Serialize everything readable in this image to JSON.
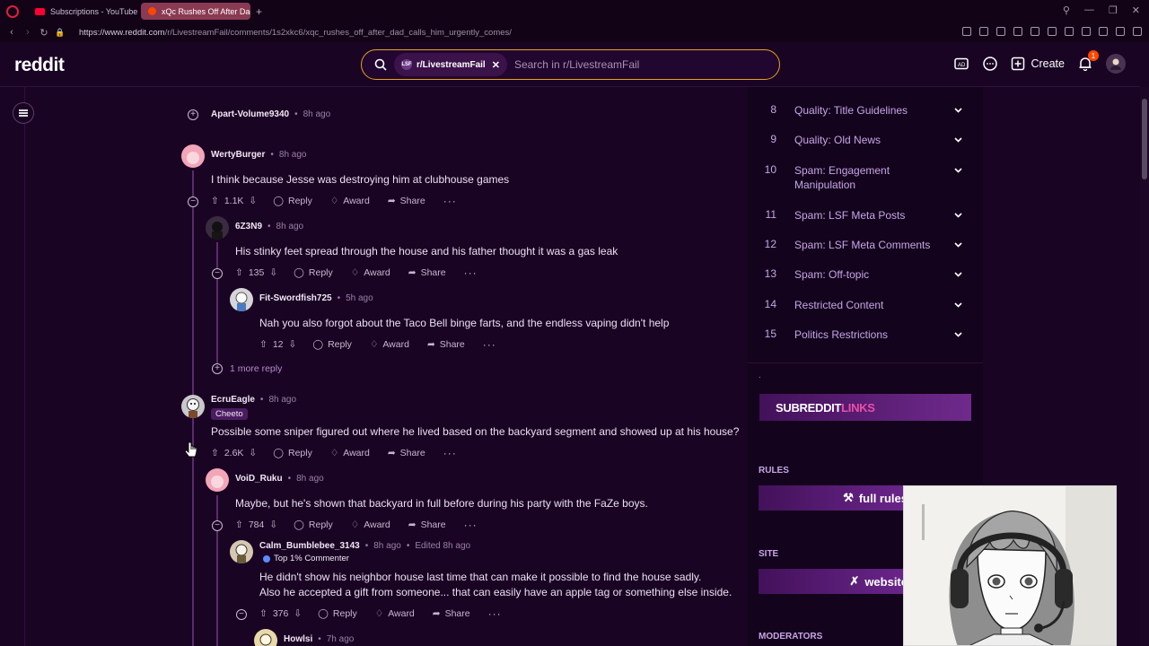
{
  "browser": {
    "tabs": [
      {
        "title": "Subscriptions - YouTube",
        "active": false,
        "fav_color": "#ff0033"
      },
      {
        "title": "xQc Rushes Off After Dad",
        "active": true,
        "fav_color": "#ff4500"
      }
    ],
    "url_host": "https://www.reddit.com",
    "url_path": "/r/LivestreamFail/comments/1s2xkc6/xqc_rushes_off_after_dad_calls_him_urgently_comes/"
  },
  "header": {
    "logo": "reddit",
    "search_chip": "r/LivestreamFail",
    "search_placeholder": "Search in r/LivestreamFail",
    "create_label": "Create",
    "notification_count": "1",
    "accent": "#e8a317"
  },
  "comments": [
    {
      "author": "Apart-Volume9340",
      "time": "8h ago",
      "collapsed": true
    },
    {
      "author": "WertyBurger",
      "time": "8h ago",
      "body": "I think because Jesse was destroying him at clubhouse games",
      "score": "1.1K",
      "reply": "Reply",
      "award": "Award",
      "share": "Share"
    },
    {
      "author": "6Z3N9",
      "time": "8h ago",
      "body": "His stinky feet spread through the house and his father thought it was a gas leak",
      "score": "135",
      "reply": "Reply",
      "award": "Award",
      "share": "Share"
    },
    {
      "author": "Fit-Swordfish725",
      "time": "5h ago",
      "body": "Nah you also forgot about the Taco Bell binge farts, and the endless vaping didn't help",
      "score": "12",
      "reply": "Reply",
      "award": "Award",
      "share": "Share"
    },
    {
      "more_replies": "1 more reply"
    },
    {
      "author": "EcruEagle",
      "time": "8h ago",
      "flair": "Cheeto",
      "body": "Possible some sniper figured out where he lived based on the backyard segment and showed up at his house?",
      "score": "2.6K",
      "reply": "Reply",
      "award": "Award",
      "share": "Share"
    },
    {
      "author": "VoiD_Ruku",
      "time": "8h ago",
      "body": "Maybe, but he's shown that backyard in full before during his party with the FaZe boys.",
      "score": "784",
      "reply": "Reply",
      "award": "Award",
      "share": "Share"
    },
    {
      "author": "Calm_Bumblebee_3143",
      "time": "8h ago",
      "edited": "Edited 8h ago",
      "flair": "Top 1% Commenter",
      "body_line1": "He didn't show his neighbor house last time that can make it possible to find the house sadly.",
      "body_line2": "Also he accepted a gift from someone... that can easily have an apple tag or something else inside.",
      "score": "376",
      "reply": "Reply",
      "award": "Award",
      "share": "Share"
    },
    {
      "author": "Howlsi",
      "time": "7h ago"
    }
  ],
  "sidebar": {
    "rules": [
      {
        "num": "8",
        "text": "Quality: Title Guidelines"
      },
      {
        "num": "9",
        "text": "Quality: Old News"
      },
      {
        "num": "10",
        "text": "Spam: Engagement Manipulation"
      },
      {
        "num": "11",
        "text": "Spam: LSF Meta Posts"
      },
      {
        "num": "12",
        "text": "Spam: LSF Meta Comments"
      },
      {
        "num": "13",
        "text": "Spam: Off-topic"
      },
      {
        "num": "14",
        "text": "Restricted Content"
      },
      {
        "num": "15",
        "text": "Politics Restrictions"
      }
    ],
    "dot": ".",
    "banner_white": "SUBREDDIT ",
    "banner_pink": "LINKS",
    "rules_label": "RULES",
    "full_rules": "full rules",
    "site_label": "SITE",
    "website": "website",
    "moderators_label": "MODERATORS"
  }
}
